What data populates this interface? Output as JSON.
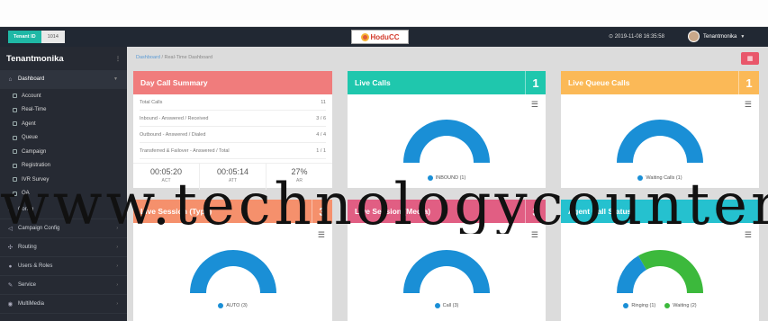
{
  "topbar": {
    "tenant_label": "Tenant ID",
    "tenant_value": "1014",
    "logo_text": "HoduCC",
    "datetime": "2019-11-08 16:35:58",
    "user_name": "Tenantmonika"
  },
  "sidebar": {
    "brand": "Tenantmonika",
    "dashboard_label": "Dashboard",
    "sub_items": [
      "Account",
      "Real-Time",
      "Agent",
      "Queue",
      "Campaign",
      "Registration",
      "IVR Survey",
      "QA"
    ],
    "items": [
      "Config",
      "Campaign Config",
      "Routing",
      "Users & Roles",
      "Service",
      "MultiMedia"
    ]
  },
  "breadcrumb": {
    "home": "Dashboard",
    "current": "Real-Time Dashboard"
  },
  "day_summary": {
    "title": "Day Call Summary",
    "rows": [
      {
        "label": "Total Calls",
        "value": "11"
      },
      {
        "label": "Inbound - Answered / Received",
        "value": "3 / 6"
      },
      {
        "label": "Outbound - Answered / Dialed",
        "value": "4 / 4"
      },
      {
        "label": "Transferred & Failover - Answered / Total",
        "value": "1 / 1"
      }
    ],
    "stats": [
      {
        "value": "00:05:20",
        "label": "ACT"
      },
      {
        "value": "00:05:14",
        "label": "ATT"
      },
      {
        "value": "27%",
        "label": "AR"
      }
    ]
  },
  "live_calls": {
    "title": "Live Calls",
    "count": "1",
    "legend": "INBOUND (1)"
  },
  "live_queue": {
    "title": "Live Queue Calls",
    "count": "1",
    "legend": "Waiting Calls (1)"
  },
  "live_session_type": {
    "title": "Live Session (Type)",
    "count": "3",
    "legend": "AUTO (3)"
  },
  "live_session_media": {
    "title": "Live Session (Media)",
    "count": "3",
    "legend": "Call (3)"
  },
  "agent_status": {
    "title": "Agent Call Status",
    "legend": [
      "Ringing (1)",
      "Waiting (2)"
    ]
  },
  "watermark": "www.technologycounter.com",
  "colors": {
    "donut_blue": "#1a8fd6",
    "donut_green": "#3cb93c"
  },
  "chart_data": [
    {
      "type": "pie",
      "categories": [
        "INBOUND"
      ],
      "values": [
        1
      ]
    },
    {
      "type": "pie",
      "categories": [
        "Waiting Calls"
      ],
      "values": [
        1
      ]
    },
    {
      "type": "pie",
      "categories": [
        "AUTO"
      ],
      "values": [
        3
      ]
    },
    {
      "type": "pie",
      "categories": [
        "Call"
      ],
      "values": [
        3
      ]
    },
    {
      "type": "pie",
      "categories": [
        "Ringing",
        "Waiting"
      ],
      "values": [
        1,
        2
      ]
    }
  ]
}
